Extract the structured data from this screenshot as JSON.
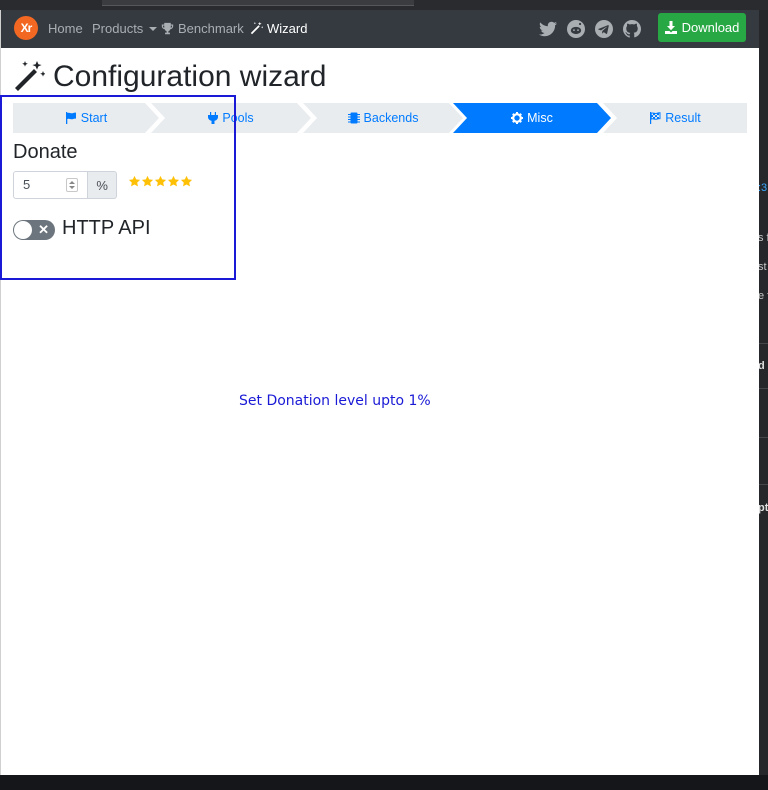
{
  "navbar": {
    "logo": "Xr",
    "items": [
      {
        "label": "Home"
      },
      {
        "label": "Products"
      },
      {
        "label": "Benchmark"
      },
      {
        "label": "Wizard"
      }
    ],
    "social_icons": [
      "twitter-icon",
      "reddit-icon",
      "telegram-icon",
      "github-icon"
    ],
    "download_label": "Download"
  },
  "page": {
    "title": "Configuration wizard"
  },
  "steps": [
    {
      "label": "Start",
      "icon": "flag-icon"
    },
    {
      "label": "Pools",
      "icon": "plug-icon"
    },
    {
      "label": "Backends",
      "icon": "chip-icon"
    },
    {
      "label": "Misc",
      "icon": "gear-icon",
      "active": true
    },
    {
      "label": "Result",
      "icon": "checkered-flag-icon"
    }
  ],
  "donate": {
    "title": "Donate",
    "value": "5",
    "unit": "%",
    "rating": 5
  },
  "http_api": {
    "label": "HTTP API",
    "enabled": false
  },
  "hint": {
    "text": "Set Donation level upto 1%"
  },
  "background": {
    "right_fragments": [
      ":3",
      "s f",
      "st",
      "e f",
      "d",
      "pt"
    ]
  },
  "colors": {
    "navbar_bg": "#343a40",
    "download_bg": "#28a745",
    "accent": "#007bff",
    "star": "#ffc107",
    "highlight": "#1a1ad6"
  }
}
